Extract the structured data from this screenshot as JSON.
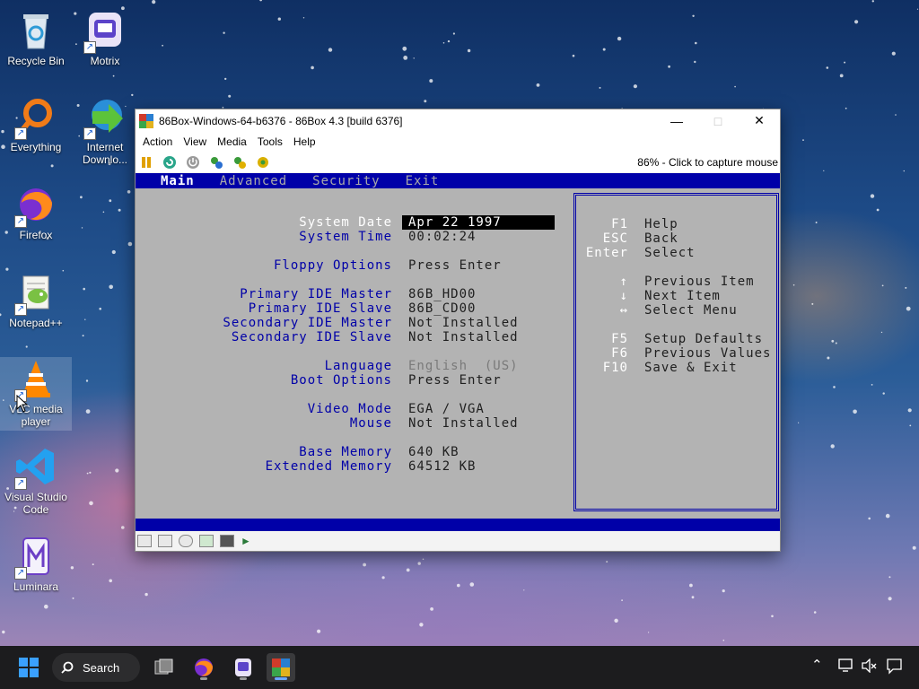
{
  "desktop_icons": [
    {
      "label": "Recycle Bin",
      "icon": "recycle-bin-icon"
    },
    {
      "label": "Motrix",
      "icon": "motrix-icon"
    },
    {
      "label": "Everything",
      "icon": "everything-search-icon"
    },
    {
      "label": "Internet Downlo...",
      "icon": "internet-download-manager-icon"
    },
    {
      "label": "Firefox",
      "icon": "firefox-icon"
    },
    {
      "label": "Notepad++",
      "icon": "notepadpp-icon"
    },
    {
      "label": "VLC media player",
      "icon": "vlc-icon"
    },
    {
      "label": "Visual Studio Code",
      "icon": "vscode-icon"
    },
    {
      "label": "Luminara",
      "icon": "luminara-icon"
    }
  ],
  "window": {
    "title": "86Box-Windows-64-b6376 - 86Box 4.3 [build 6376]",
    "menu": [
      "Action",
      "View",
      "Media",
      "Tools",
      "Help"
    ],
    "toolbar_status": "86% - Click to capture mouse"
  },
  "bios": {
    "tabs": [
      "Main",
      "Advanced",
      "Security",
      "Exit"
    ],
    "active_tab": "Main",
    "fields": [
      {
        "label": "System Date",
        "value": "Apr 22 1997"
      },
      {
        "label": "System Time",
        "value": "00:02:24"
      },
      {
        "label": "Floppy Options",
        "value": "Press Enter"
      },
      {
        "label": "Primary IDE Master",
        "value": "86B_HD00"
      },
      {
        "label": "Primary IDE Slave",
        "value": "86B_CD00"
      },
      {
        "label": "Secondary IDE Master",
        "value": "Not Installed"
      },
      {
        "label": "Secondary IDE Slave",
        "value": "Not Installed"
      },
      {
        "label": "Language",
        "value": "English  (US)"
      },
      {
        "label": "Boot Options",
        "value": "Press Enter"
      },
      {
        "label": "Video Mode",
        "value": "EGA / VGA"
      },
      {
        "label": "Mouse",
        "value": "Not Installed"
      },
      {
        "label": "Base Memory",
        "value": "640 KB"
      },
      {
        "label": "Extended Memory",
        "value": "64512 KB"
      }
    ],
    "help": [
      {
        "key": "F1",
        "text": "Help"
      },
      {
        "key": "ESC",
        "text": "Back"
      },
      {
        "key": "Enter",
        "text": "Select"
      },
      {
        "key": "↑",
        "text": "Previous Item"
      },
      {
        "key": "↓",
        "text": "Next Item"
      },
      {
        "key": "↔",
        "text": "Select Menu"
      },
      {
        "key": "F5",
        "text": "Setup Defaults"
      },
      {
        "key": "F6",
        "text": "Previous Values"
      },
      {
        "key": "F10",
        "text": "Save & Exit"
      }
    ]
  },
  "taskbar": {
    "search_label": "Search"
  },
  "colors": {
    "bios_blue": "#0000a8",
    "bios_gray": "#b3b3b3",
    "taskbar": "#1c1c1e"
  }
}
